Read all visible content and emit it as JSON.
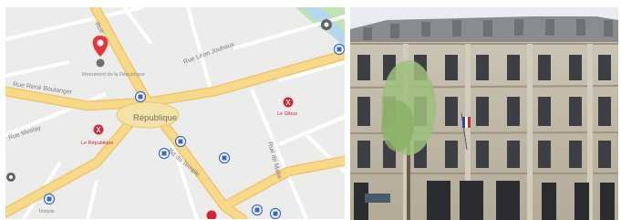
{
  "map": {
    "labels": {
      "rue_rene_boulanger": "Rue René Boulanger",
      "rue_leon_jouhaux": "Rue Léon Jouhaux",
      "rue_de_malte": "Rue de Malte",
      "rue_meslay": "Rue Meslay",
      "bd_du_temple": "Bd du Temple",
      "republique": "République",
      "marker_caption": "Monument de la République",
      "le_republique": "Le République",
      "le_poi_right": "Le Gibus",
      "temple": "Temple"
    },
    "colors": {
      "background": "#ececea",
      "major_road": "#f7d98a",
      "major_road_edge": "#efc56a",
      "minor_road": "#ffffff",
      "green_area": "#bfe3b4",
      "water": "#b7d7ef",
      "pin": "#e8333f",
      "restaurant": "#d2263a",
      "metro": "#3a67c6"
    },
    "icons": [
      "map-pin-icon",
      "restaurant-icon",
      "metro-icon",
      "bus-icon",
      "place-icon"
    ]
  },
  "photo": {
    "subject": "Haussmann-style stone building facade with French flag",
    "colors": {
      "sky": "#dfe4ea",
      "stone": "#c2b9a8",
      "stone_dark": "#a89f8d",
      "roof": "#8a8b8f",
      "window": "#3d3f44",
      "tree": "#9dbf7a",
      "door": "#2b2c30"
    }
  }
}
